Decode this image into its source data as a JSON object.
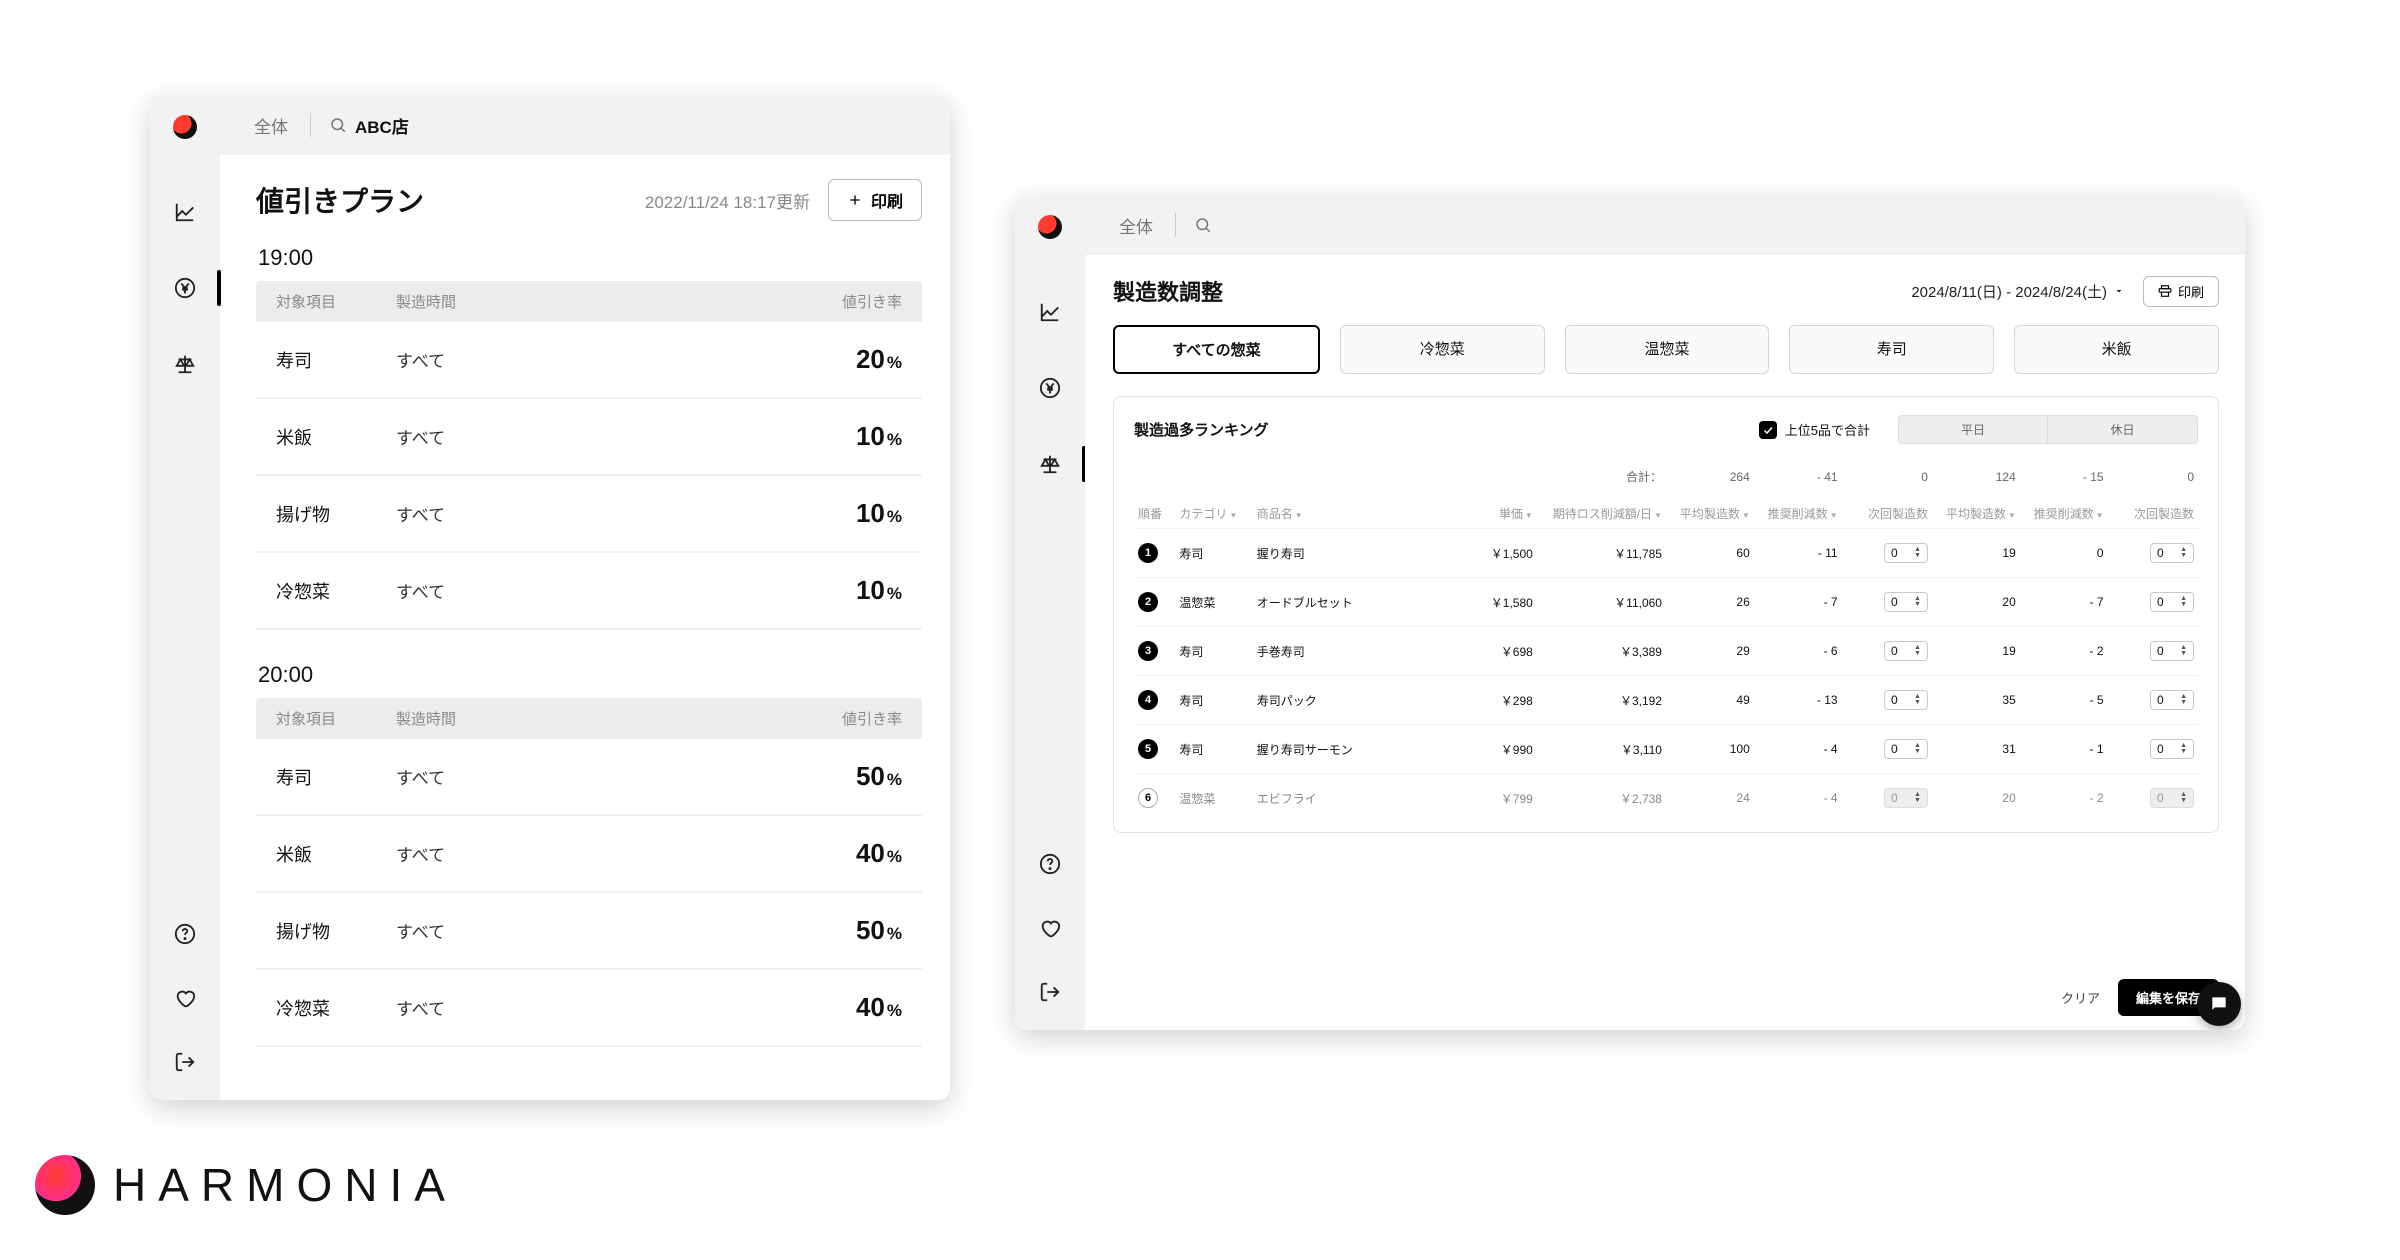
{
  "brand_name": "HARMONIA",
  "left": {
    "crumb_all": "全体",
    "store": "ABC店",
    "title": "値引きプラン",
    "updated": "2022/11/24 18:17更新",
    "print_label": "印刷",
    "headers": {
      "c1": "対象項目",
      "c2": "製造時間",
      "c3": "値引き率"
    },
    "pct": "%",
    "sections": [
      {
        "time": "19:00",
        "rows": [
          {
            "item": "寿司",
            "time": "すべて",
            "rate": "20"
          },
          {
            "item": "米飯",
            "time": "すべて",
            "rate": "10"
          },
          {
            "item": "揚げ物",
            "time": "すべて",
            "rate": "10"
          },
          {
            "item": "冷惣菜",
            "time": "すべて",
            "rate": "10"
          }
        ]
      },
      {
        "time": "20:00",
        "rows": [
          {
            "item": "寿司",
            "time": "すべて",
            "rate": "50"
          },
          {
            "item": "米飯",
            "time": "すべて",
            "rate": "40"
          },
          {
            "item": "揚げ物",
            "time": "すべて",
            "rate": "50"
          },
          {
            "item": "冷惣菜",
            "time": "すべて",
            "rate": "40"
          }
        ]
      }
    ]
  },
  "right": {
    "crumb_all": "全体",
    "title": "製造数調整",
    "date_range": "2024/8/11(日) - 2024/8/24(土)",
    "print_label": "印刷",
    "tabs": [
      "すべての惣菜",
      "冷惣菜",
      "温惣菜",
      "寿司",
      "米飯"
    ],
    "card_title": "製造過多ランキング",
    "chk_label": "上位5品で合計",
    "seg": [
      "平日",
      "休日"
    ],
    "headers": {
      "rank": "順番",
      "category": "カテゴリ",
      "name": "商品名",
      "price": "単価",
      "loss": "期待ロス削減額/日",
      "avg1": "平均製造数",
      "rec1": "推奨削減数",
      "next1": "次回製造数",
      "avg2": "平均製造数",
      "rec2": "推奨削減数",
      "next2": "次回製造数"
    },
    "sum_label": "合計：",
    "sum": {
      "a": "264",
      "b": "- 41",
      "c": "0",
      "d": "124",
      "e": "- 15",
      "f": "0"
    },
    "rows": [
      {
        "rank": "1",
        "cat": "寿司",
        "name": "握り寿司",
        "price": "￥1,500",
        "loss": "￥11,785",
        "a": "60",
        "b": "- 11",
        "c": "0",
        "d": "19",
        "e": "0",
        "f": "0"
      },
      {
        "rank": "2",
        "cat": "温惣菜",
        "name": "オードブルセット",
        "price": "￥1,580",
        "loss": "￥11,060",
        "a": "26",
        "b": "- 7",
        "c": "0",
        "d": "20",
        "e": "- 7",
        "f": "0"
      },
      {
        "rank": "3",
        "cat": "寿司",
        "name": "手巻寿司",
        "price": "￥698",
        "loss": "￥3,389",
        "a": "29",
        "b": "- 6",
        "c": "0",
        "d": "19",
        "e": "- 2",
        "f": "0"
      },
      {
        "rank": "4",
        "cat": "寿司",
        "name": "寿司パック",
        "price": "￥298",
        "loss": "￥3,192",
        "a": "49",
        "b": "- 13",
        "c": "0",
        "d": "35",
        "e": "- 5",
        "f": "0"
      },
      {
        "rank": "5",
        "cat": "寿司",
        "name": "握り寿司サーモン",
        "price": "￥990",
        "loss": "￥3,110",
        "a": "100",
        "b": "- 4",
        "c": "0",
        "d": "31",
        "e": "- 1",
        "f": "0"
      },
      {
        "rank": "6",
        "cat": "温惣菜",
        "name": "エビフライ",
        "price": "￥799",
        "loss": "￥2,738",
        "a": "24",
        "b": "- 4",
        "c": "0",
        "d": "20",
        "e": "- 2",
        "f": "0",
        "cutoff": true,
        "disabled": true
      }
    ],
    "clear_label": "クリア",
    "save_label": "編集を保存"
  }
}
